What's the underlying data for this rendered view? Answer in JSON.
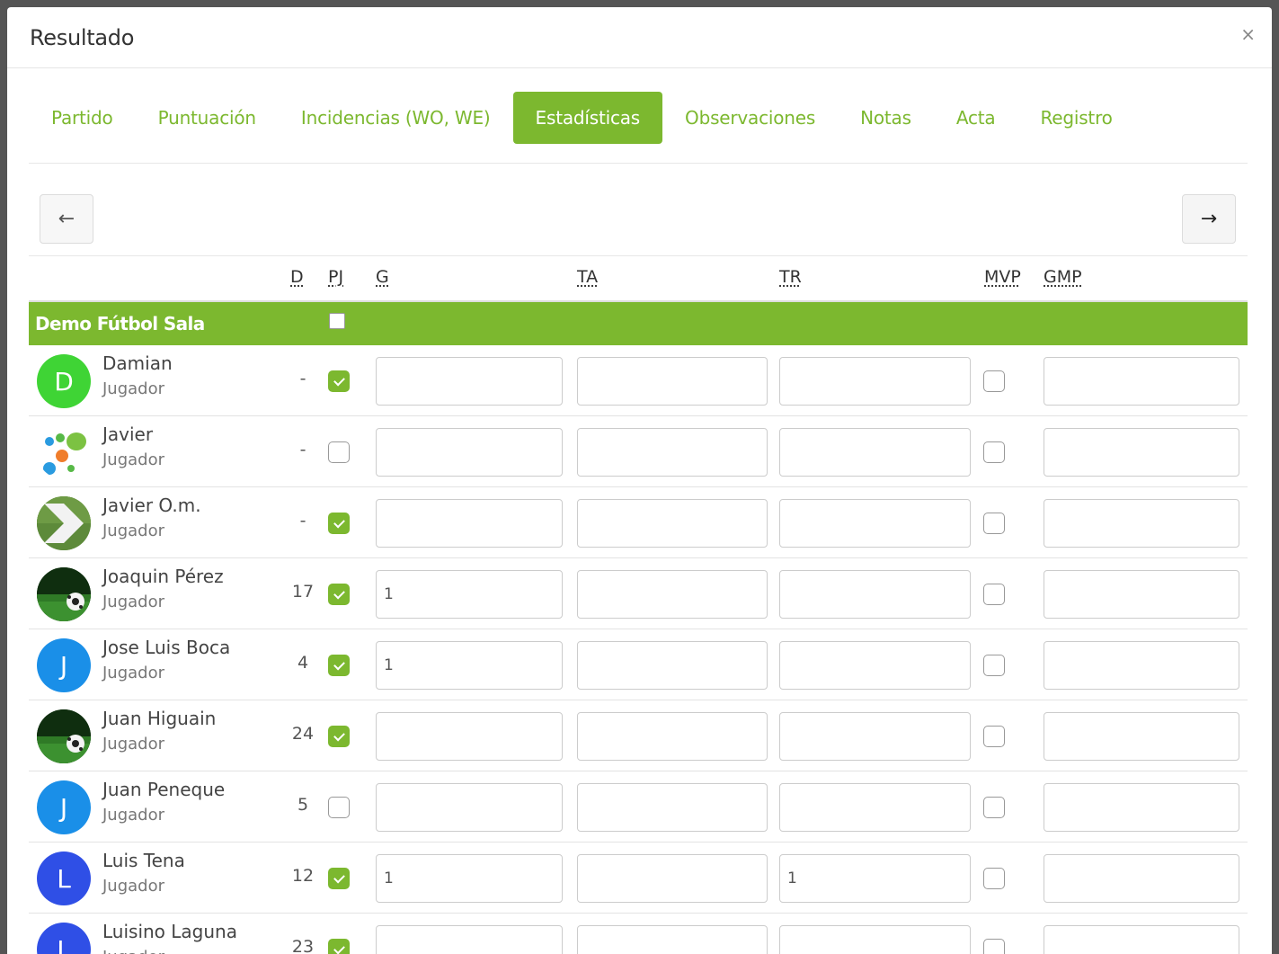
{
  "modal": {
    "title": "Resultado",
    "close_label": "×"
  },
  "tabs": [
    {
      "label": "Partido",
      "active": false
    },
    {
      "label": "Puntuación",
      "active": false
    },
    {
      "label": "Incidencias (WO, WE)",
      "active": false
    },
    {
      "label": "Estadísticas",
      "active": true
    },
    {
      "label": "Observaciones",
      "active": false
    },
    {
      "label": "Notas",
      "active": false
    },
    {
      "label": "Acta",
      "active": false
    },
    {
      "label": "Registro",
      "active": false
    }
  ],
  "nav": {
    "prev_icon": "arrow-left-icon",
    "next_icon": "arrow-right-icon",
    "prev_glyph": "←",
    "next_glyph": "→"
  },
  "columns": {
    "d": "D",
    "pj": "PJ",
    "g": "G",
    "ta": "TA",
    "tr": "TR",
    "mvp": "MVP",
    "gmp": "GMP"
  },
  "team": {
    "name": "Demo Fútbol Sala",
    "checked": false
  },
  "accent_color": "#7cb82f",
  "players": [
    {
      "name": "Damian",
      "role": "Jugador",
      "dorsal": "-",
      "avatar_letter": "D",
      "avatar_color": "#3fd435",
      "avatar_type": "letter",
      "pj": true,
      "g": "",
      "ta": "",
      "tr": "",
      "mvp": false,
      "gmp": ""
    },
    {
      "name": "Javier",
      "role": "Jugador",
      "dorsal": "-",
      "avatar_letter": "",
      "avatar_color": "#ffffff",
      "avatar_type": "dots",
      "pj": false,
      "g": "",
      "ta": "",
      "tr": "",
      "mvp": false,
      "gmp": ""
    },
    {
      "name": "Javier O.m.",
      "role": "Jugador",
      "dorsal": "-",
      "avatar_letter": "",
      "avatar_color": "#5d8a3a",
      "avatar_type": "chevron",
      "pj": true,
      "g": "",
      "ta": "",
      "tr": "",
      "mvp": false,
      "gmp": ""
    },
    {
      "name": "Joaquin Pérez",
      "role": "Jugador",
      "dorsal": "17",
      "avatar_letter": "",
      "avatar_color": "#1f4d1c",
      "avatar_type": "ball",
      "pj": true,
      "g": "1",
      "ta": "",
      "tr": "",
      "mvp": false,
      "gmp": ""
    },
    {
      "name": "Jose Luis Boca",
      "role": "Jugador",
      "dorsal": "4",
      "avatar_letter": "J",
      "avatar_color": "#1a8fe8",
      "avatar_type": "letter",
      "pj": true,
      "g": "1",
      "ta": "",
      "tr": "",
      "mvp": false,
      "gmp": ""
    },
    {
      "name": "Juan Higuain",
      "role": "Jugador",
      "dorsal": "24",
      "avatar_letter": "",
      "avatar_color": "#1f4d1c",
      "avatar_type": "ball",
      "pj": true,
      "g": "",
      "ta": "",
      "tr": "",
      "mvp": false,
      "gmp": ""
    },
    {
      "name": "Juan Peneque",
      "role": "Jugador",
      "dorsal": "5",
      "avatar_letter": "J",
      "avatar_color": "#1a8fe8",
      "avatar_type": "letter",
      "pj": false,
      "g": "",
      "ta": "",
      "tr": "",
      "mvp": false,
      "gmp": ""
    },
    {
      "name": "Luis Tena",
      "role": "Jugador",
      "dorsal": "12",
      "avatar_letter": "L",
      "avatar_color": "#2f4fe6",
      "avatar_type": "letter",
      "pj": true,
      "g": "1",
      "ta": "",
      "tr": "1",
      "mvp": false,
      "gmp": ""
    },
    {
      "name": "Luisino Laguna",
      "role": "Jugador",
      "dorsal": "23",
      "avatar_letter": "L",
      "avatar_color": "#2f4fe6",
      "avatar_type": "letter",
      "pj": true,
      "g": "",
      "ta": "",
      "tr": "",
      "mvp": false,
      "gmp": ""
    }
  ]
}
